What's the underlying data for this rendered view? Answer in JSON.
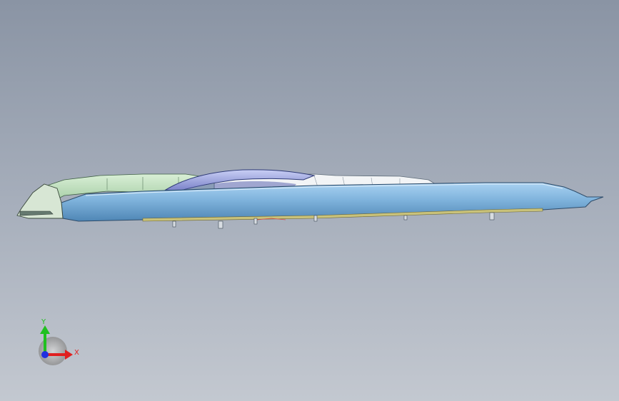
{
  "viewport": {
    "background_top": "#8a94a4",
    "background_bottom": "#c3c8d0"
  },
  "model": {
    "shell_color": "#7fb3dc",
    "shell_edge_color": "#2f4d6b",
    "inner_green_color": "#b8d9b8",
    "inner_white_color": "#eef2f5",
    "dome_color": "#8f98d8",
    "rib_color": "#c9c27a"
  },
  "triad": {
    "x_label": "X",
    "y_label": "Y",
    "x_color": "#e02020",
    "y_color": "#20c020",
    "z_color": "#2030e0",
    "icon": "coordinate-triad-icon"
  }
}
